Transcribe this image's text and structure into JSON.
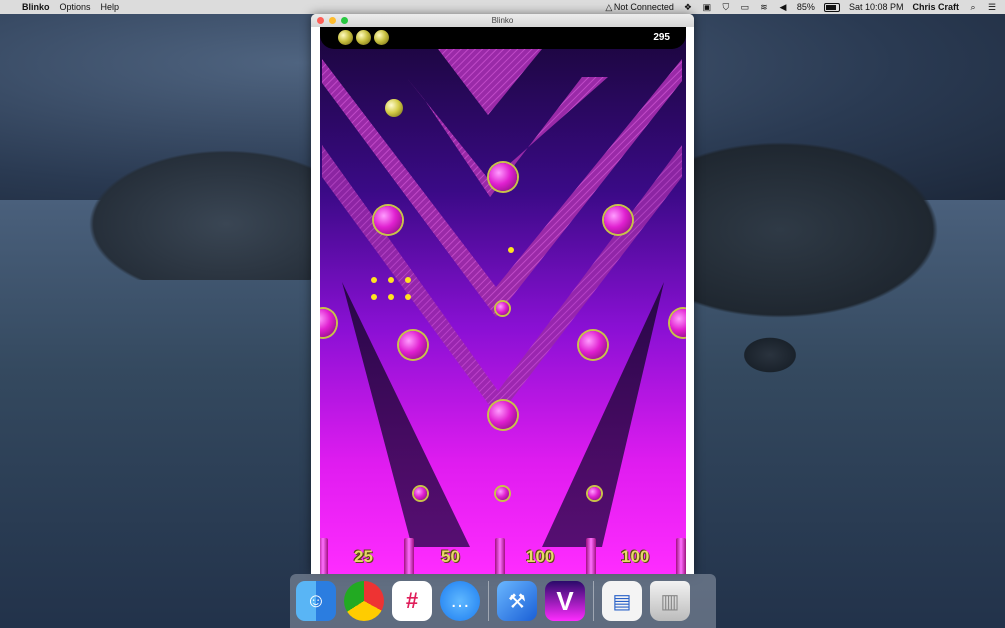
{
  "menubar": {
    "app_name": "Blinko",
    "menus": [
      "Options",
      "Help"
    ],
    "status_network": "Not Connected",
    "battery": "85%",
    "clock": "Sat 10:08 PM",
    "user": "Chris Craft"
  },
  "window": {
    "title": "Blinko"
  },
  "game": {
    "balls_remaining": 3,
    "score": "295",
    "slots": [
      "25",
      "50",
      "100",
      "100"
    ]
  },
  "dock": {
    "apps": [
      "finder-icon",
      "chrome-icon",
      "slack-icon",
      "messages-icon",
      "xcode-icon",
      "blinko-icon",
      "preview-icon",
      "trash-icon"
    ]
  },
  "colors": {
    "accent": "#ff2cff",
    "peg": "#e020d0",
    "ball": "#d4cc48",
    "slot_text": "#e8d86a"
  }
}
